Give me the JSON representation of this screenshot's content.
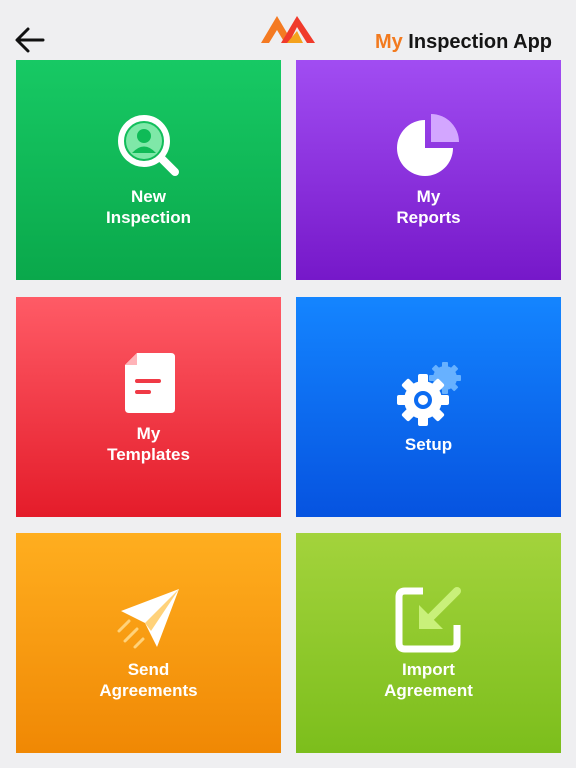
{
  "header": {
    "title_accent": "My",
    "title_main": "Inspection App",
    "accent_color": "#f27a1f"
  },
  "tiles": [
    {
      "label": "New\nInspection",
      "icon": "magnifier-person-icon",
      "color": "#0fbb57"
    },
    {
      "label": "My\nReports",
      "icon": "pie-chart-icon",
      "color": "#8a2ee0"
    },
    {
      "label": "My\nTemplates",
      "icon": "document-icon",
      "color": "#f03a46"
    },
    {
      "label": "Setup",
      "icon": "gear-icon",
      "color": "#0c6cf2"
    },
    {
      "label": "Send\nAgreements",
      "icon": "paper-plane-icon",
      "color": "#f89a10"
    },
    {
      "label": "Import\nAgreement",
      "icon": "import-arrow-icon",
      "color": "#8fc92b"
    }
  ]
}
